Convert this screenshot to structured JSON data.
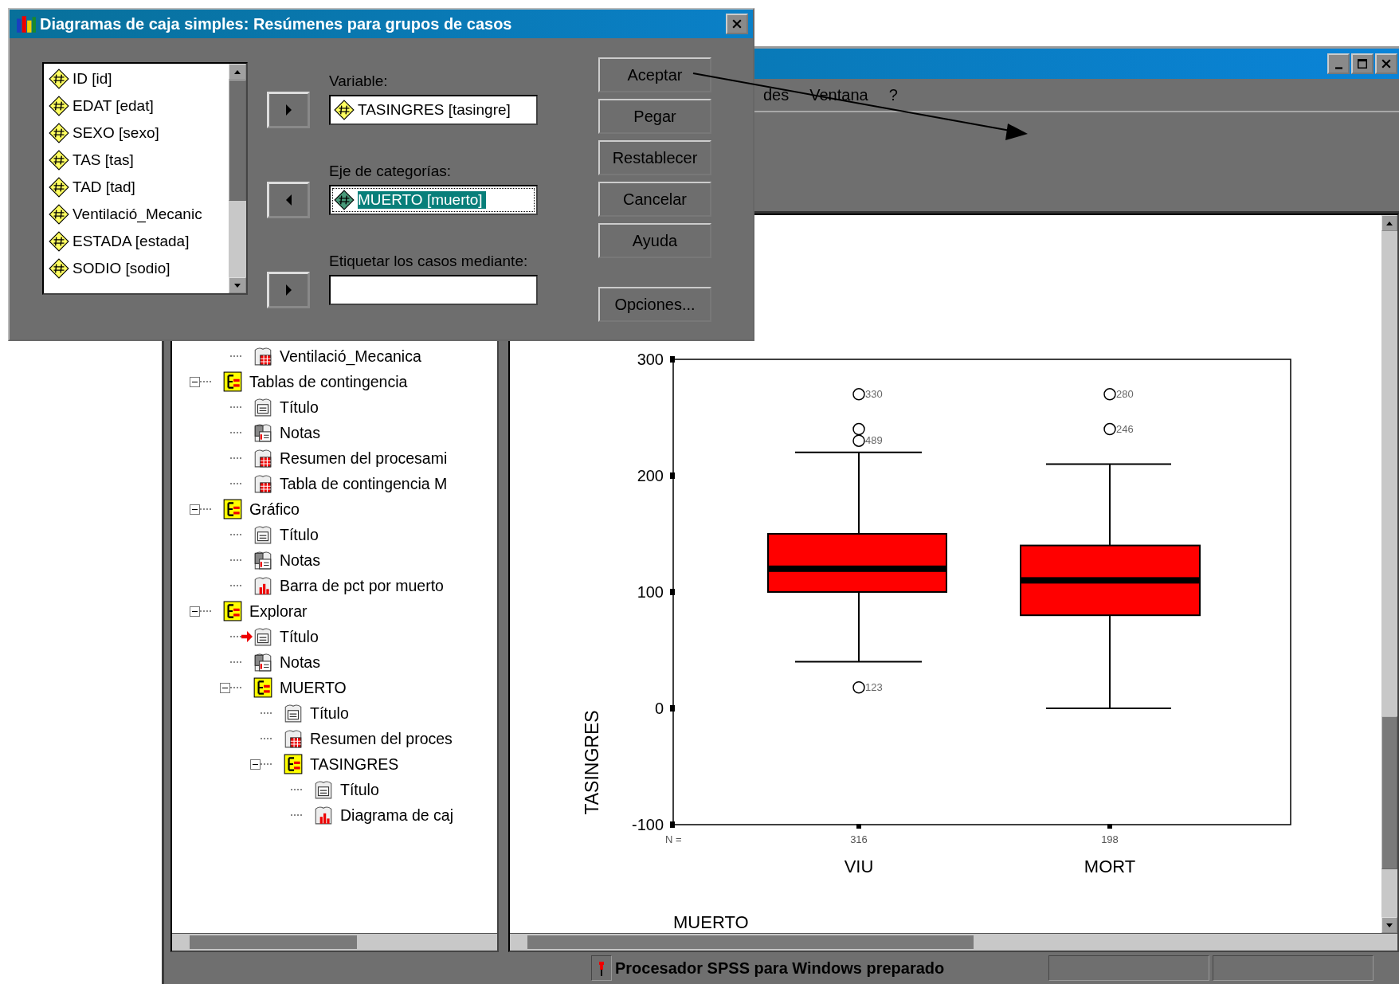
{
  "dialog": {
    "title": "Diagramas de caja simples: Resúmenes para grupos de casos",
    "variables": [
      {
        "label": "ID [id]"
      },
      {
        "label": "EDAT [edat]"
      },
      {
        "label": "SEXO [sexo]"
      },
      {
        "label": "TAS [tas]"
      },
      {
        "label": "TAD [tad]"
      },
      {
        "label": "Ventilació_Mecanic"
      },
      {
        "label": "ESTADA [estada]"
      },
      {
        "label": "SODIO [sodio]"
      }
    ],
    "transfer_buttons": [
      {
        "kind": "right"
      },
      {
        "kind": "left"
      },
      {
        "kind": "right"
      }
    ],
    "fields": [
      {
        "label": "Variable:",
        "value": "TASINGRES [tasingre]",
        "selected": false
      },
      {
        "label": "Eje de categorías:",
        "value": "MUERTO [muerto]",
        "selected": true
      },
      {
        "label": "Etiquetar los casos mediante:",
        "selected": false
      }
    ],
    "buttons": [
      "Aceptar",
      "Pegar",
      "Restablecer",
      "Cancelar",
      "Ayuda"
    ],
    "options_button": "Opciones..."
  },
  "main_window": {
    "menu": [
      "des",
      "Ventana",
      "?"
    ],
    "tree": {
      "continued_items": [
        {
          "label": "Ventilació_Mecanica",
          "kind": "table",
          "current": false
        }
      ],
      "items": [
        {
          "label": "Tablas de contingencia",
          "kind": "book",
          "expanded": true,
          "current": false,
          "children": [
            {
              "label": "Título",
              "kind": "title",
              "current": false
            },
            {
              "label": "Notas",
              "kind": "notes",
              "current": false
            },
            {
              "label": "Resumen del procesami",
              "kind": "table",
              "current": false
            },
            {
              "label": "Tabla de contingencia M",
              "kind": "table",
              "current": false
            }
          ]
        },
        {
          "label": "Gráfico",
          "kind": "book",
          "expanded": true,
          "current": false,
          "children": [
            {
              "label": "Título",
              "kind": "title",
              "current": false
            },
            {
              "label": "Notas",
              "kind": "notes",
              "current": false
            },
            {
              "label": "Barra de pct por muerto",
              "kind": "chart",
              "current": false
            }
          ]
        },
        {
          "label": "Explorar",
          "kind": "book",
          "expanded": true,
          "current": false,
          "children": [
            {
              "label": "Título",
              "kind": "title",
              "current": true
            },
            {
              "label": "Notas",
              "kind": "notes",
              "current": false
            },
            {
              "label": "MUERTO",
              "kind": "book",
              "expanded": true,
              "current": false,
              "children": [
                {
                  "label": "Título",
                  "kind": "title",
                  "current": false
                },
                {
                  "label": "Resumen del proces",
                  "kind": "table",
                  "current": false
                },
                {
                  "label": "TASINGRES",
                  "kind": "book",
                  "expanded": true,
                  "current": false,
                  "children": [
                    {
                      "label": "Título",
                      "kind": "title",
                      "current": false
                    },
                    {
                      "label": "Diagrama de caj",
                      "kind": "chart",
                      "current": false
                    }
                  ]
                }
              ]
            }
          ]
        }
      ]
    },
    "chart": {
      "y_axis_title": "TASINGRES",
      "x_axis_title": "MUERTO",
      "y_ticks": [
        "300",
        "200",
        "100",
        "0",
        "-100"
      ],
      "n_label": "N =",
      "groups": [
        {
          "name": "VIU",
          "n": "316",
          "outlier_labels": [
            "330",
            "489",
            "123"
          ]
        },
        {
          "name": "MORT",
          "n": "198",
          "outlier_labels": [
            "280",
            "246"
          ]
        }
      ]
    },
    "status_bar": "Procesador SPSS para Windows preparado"
  }
}
